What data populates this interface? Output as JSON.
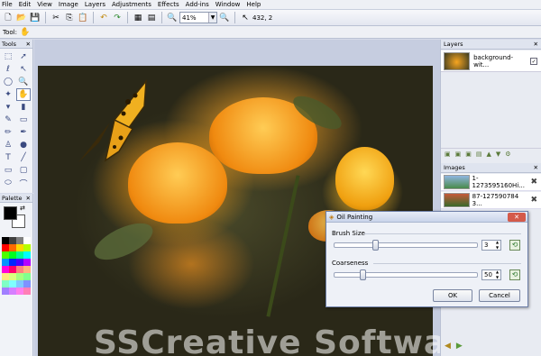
{
  "menu": [
    "File",
    "Edit",
    "View",
    "Image",
    "Layers",
    "Adjustments",
    "Effects",
    "Add-ins",
    "Window",
    "Help"
  ],
  "toolbar": {
    "zoom_value": "41%",
    "coords": "432, 2"
  },
  "tool_row": {
    "label": "Tool:"
  },
  "tools_panel": {
    "title": "Tools"
  },
  "palette_panel": {
    "title": "Palette"
  },
  "layers_panel": {
    "title": "Layers",
    "layer_name": "background-wit...",
    "layer_visible": "✓"
  },
  "images_panel": {
    "title": "Images",
    "items": [
      "1-1273595160Hi...",
      "87-127590784 3..."
    ]
  },
  "dialog": {
    "title": "Oil Painting",
    "brush_label": "Brush Size",
    "brush_value": "3",
    "coarse_label": "Coarseness",
    "coarse_value": "50",
    "ok_label": "OK",
    "cancel_label": "Cancel"
  },
  "watermark": "SSCreative Software",
  "colors": {
    "accent": "#6d7fa8",
    "palette": [
      "#000000",
      "#404040",
      "#7f7f7f",
      "#ffffff",
      "#ff0000",
      "#ff6a00",
      "#ffd800",
      "#b6ff00",
      "#4cff00",
      "#00ff21",
      "#00ff90",
      "#00ffff",
      "#0094ff",
      "#0026ff",
      "#4800ff",
      "#b200ff",
      "#ff00dc",
      "#ff006e",
      "#ff7f7f",
      "#ffb27f",
      "#ffe97f",
      "#daff7f",
      "#a5ff7f",
      "#7fff8e",
      "#7fffc5",
      "#7fffff",
      "#7fc9ff",
      "#7f92ff",
      "#a17fff",
      "#d67fff",
      "#ff7fed",
      "#ff7fb6"
    ]
  }
}
